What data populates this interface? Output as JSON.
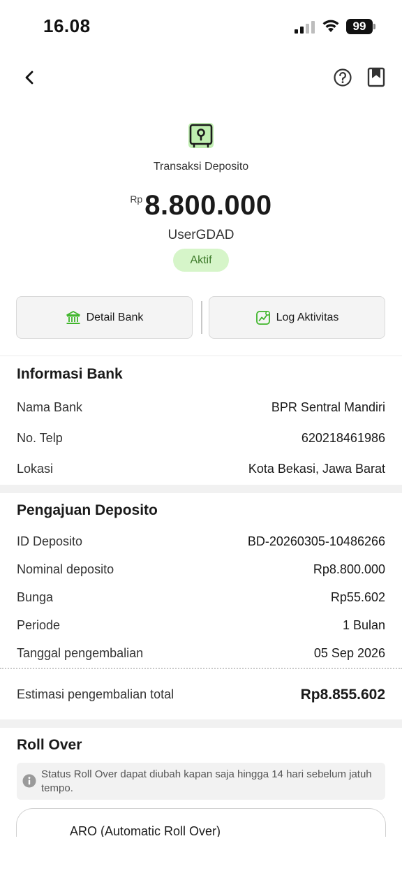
{
  "status_bar": {
    "time": "16.08",
    "battery": "99"
  },
  "header": {
    "icons": {
      "back": "chevron-left-icon",
      "help": "question-circle-icon",
      "bookmark": "bookmark-icon"
    }
  },
  "hero": {
    "icon": "safe-deposit-icon",
    "label": "Transaksi Deposito",
    "currency": "Rp",
    "amount": "8.800.000",
    "user": "UserGDAD",
    "status": "Aktif"
  },
  "actions": {
    "detail_bank": "Detail Bank",
    "log_aktivitas": "Log Aktivitas"
  },
  "bank_info": {
    "title": "Informasi Bank",
    "rows": [
      {
        "label": "Nama Bank",
        "value": "BPR Sentral Mandiri"
      },
      {
        "label": "No. Telp",
        "value": "620218461986"
      },
      {
        "label": "Lokasi",
        "value": "Kota Bekasi, Jawa Barat"
      }
    ]
  },
  "deposit": {
    "title": "Pengajuan Deposito",
    "rows": [
      {
        "label": "ID Deposito",
        "value": "BD-20260305-10486266"
      },
      {
        "label": "Nominal deposito",
        "value": "Rp8.800.000"
      },
      {
        "label": "Bunga",
        "value": "Rp55.602"
      },
      {
        "label": "Periode",
        "value": "1 Bulan"
      },
      {
        "label": "Tanggal pengembalian",
        "value": "05 Sep 2026"
      }
    ],
    "total_label": "Estimasi pengembalian total",
    "total_value": "Rp8.855.602"
  },
  "roll_over": {
    "title": "Roll Over",
    "info": "Status Roll Over dapat diubah kapan saja hingga 14 hari sebelum jatuh tempo.",
    "option": "ARO (Automatic Roll Over)"
  },
  "colors": {
    "accent_green": "#3fb52a",
    "pill_bg": "#d6f5c9",
    "pill_text": "#3d7a2a"
  }
}
